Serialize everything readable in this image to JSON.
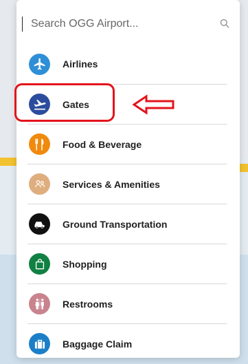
{
  "search": {
    "placeholder": "Search OGG Airport..."
  },
  "menu": {
    "items": [
      {
        "label": "Airlines",
        "icon": "airplane-icon",
        "color": "#2e8fd6"
      },
      {
        "label": "Gates",
        "icon": "plane-departure-icon",
        "color": "#2c4d9e"
      },
      {
        "label": "Food & Beverage",
        "icon": "fork-knife-icon",
        "color": "#f08a0d"
      },
      {
        "label": "Services & Amenities",
        "icon": "people-icon",
        "color": "#dfae7e"
      },
      {
        "label": "Ground Transportation",
        "icon": "car-icon",
        "color": "#111111"
      },
      {
        "label": "Shopping",
        "icon": "shopping-bag-icon",
        "color": "#108043"
      },
      {
        "label": "Restrooms",
        "icon": "restroom-icon",
        "color": "#c9838e"
      },
      {
        "label": "Baggage Claim",
        "icon": "luggage-icon",
        "color": "#1b7fc8"
      }
    ]
  },
  "annotation": {
    "highlight_color": "#e3141c"
  }
}
